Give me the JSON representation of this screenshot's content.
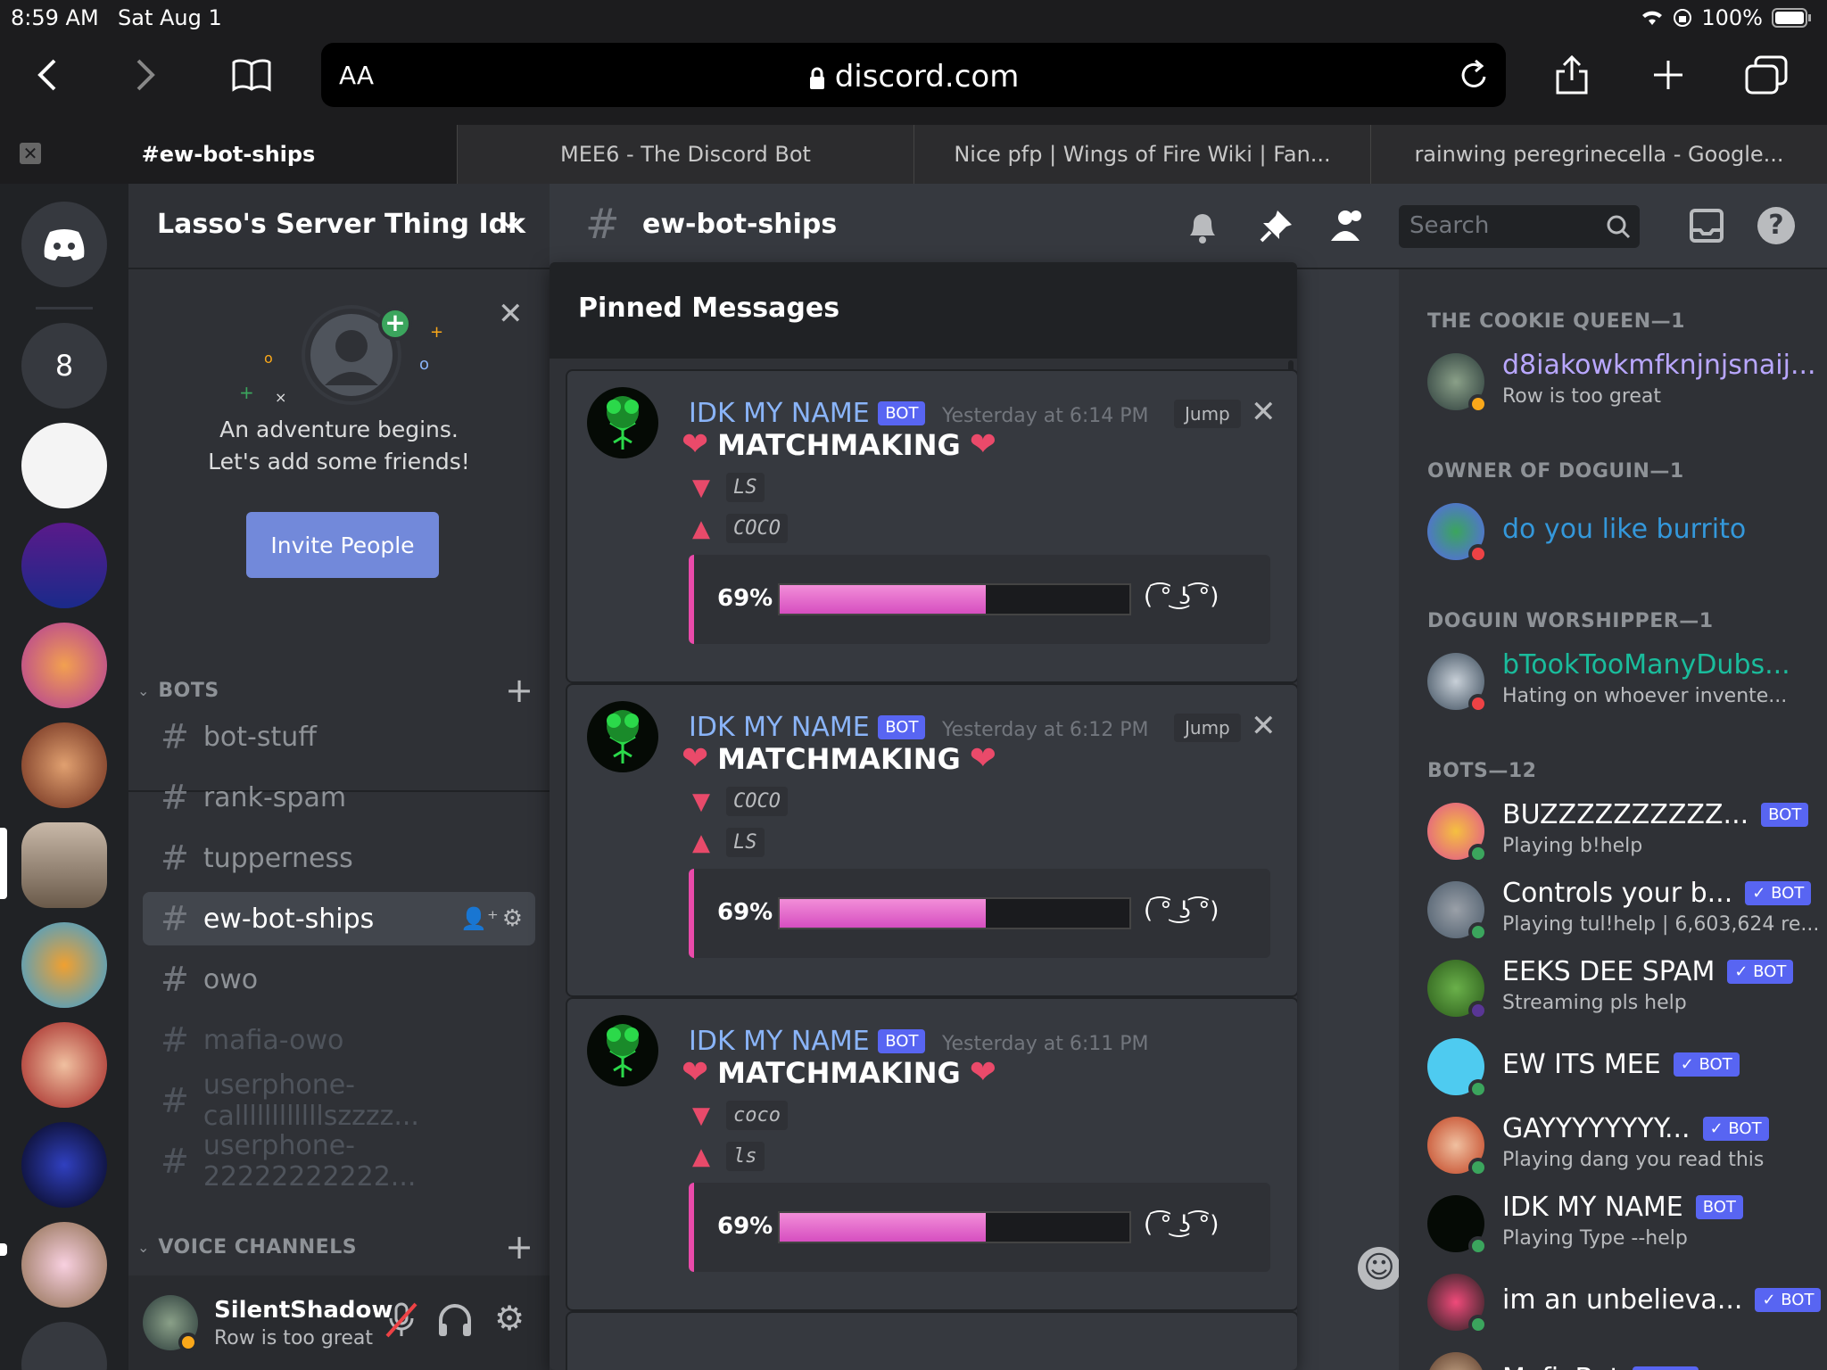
{
  "status_bar": {
    "time": "8:59 AM",
    "date": "Sat Aug 1",
    "battery": "100%"
  },
  "browser": {
    "url_domain": "discord.com",
    "aa_label": "AA",
    "tabs": [
      {
        "label": "#ew-bot-ships",
        "active": true
      },
      {
        "label": "MEE6 - The Discord Bot",
        "active": false
      },
      {
        "label": "Nice pfp | Wings of Fire Wiki | Fan...",
        "active": false
      },
      {
        "label": "rainwing peregrinecella - Google...",
        "active": false
      }
    ]
  },
  "guilds": {
    "unread_count": "8"
  },
  "server": {
    "name": "Lasso's Server Thing Idk",
    "invite_card": {
      "line1": "An adventure begins.",
      "line2": "Let's add some friends!",
      "button": "Invite People"
    },
    "categories": {
      "bots": "BOTS",
      "voice": "VOICE CHANNELS"
    },
    "channels": [
      {
        "name": "bot-stuff",
        "state": "normal"
      },
      {
        "name": "rank-spam",
        "state": "normal"
      },
      {
        "name": "tupperness",
        "state": "normal"
      },
      {
        "name": "ew-bot-ships",
        "state": "selected"
      },
      {
        "name": "owo",
        "state": "normal"
      },
      {
        "name": "mafia-owo",
        "state": "muted"
      },
      {
        "name": "userphone-callllllllllllszzzz...",
        "state": "muted"
      },
      {
        "name": "userphone-22222222222...",
        "state": "muted"
      }
    ]
  },
  "user": {
    "name": "SilentShadow",
    "status": "Row is too great"
  },
  "channel_header": {
    "name": "ew-bot-ships",
    "search_placeholder": "Search"
  },
  "pinned": {
    "title": "Pinned Messages",
    "messages": [
      {
        "author": "IDK MY NAME",
        "badge": "BOT",
        "time": "Yesterday at 6:14 PM",
        "jump": "Jump",
        "title": "MATCHMAKING",
        "down": "LS",
        "up": "COCO",
        "percent": "69%",
        "face": "( ͡° ͜ʖ ͡°)",
        "level": 0.59
      },
      {
        "author": "IDK MY NAME",
        "badge": "BOT",
        "time": "Yesterday at 6:12 PM",
        "jump": "Jump",
        "title": "MATCHMAKING",
        "down": "COCO",
        "up": "LS",
        "percent": "69%",
        "face": "( ͡° ͜ʖ ͡°)",
        "level": 0.59
      },
      {
        "author": "IDK MY NAME",
        "badge": "BOT",
        "time": "Yesterday at 6:11 PM",
        "jump": "",
        "title": "MATCHMAKING",
        "down": "coco",
        "up": "ls",
        "percent": "69%",
        "face": "( ͡° ͜ʖ ͡°)",
        "level": 0.59
      }
    ]
  },
  "members": {
    "groups": [
      {
        "title": "THE COOKIE QUEEN—1",
        "items": [
          {
            "name": "d8iakowkmfknjnjsnaij...",
            "sub": "Row is too great",
            "name_color": "#b9a7ff",
            "bot": "",
            "status": "idle"
          }
        ]
      },
      {
        "title": "OWNER OF DOGUIN—1",
        "items": [
          {
            "name": "do you like burrito",
            "sub": "",
            "name_color": "#3498db",
            "bot": "",
            "status": "dnd"
          }
        ]
      },
      {
        "title": "DOGUIN WORSHIPPER—1",
        "items": [
          {
            "name": "bTookTooManyDubs...",
            "sub": "Hating on whoever invente...",
            "name_color": "#1abc9c",
            "bot": "",
            "status": "dnd"
          }
        ]
      },
      {
        "title": "BOTS—12",
        "items": [
          {
            "name": "BUZZZZZZZZZZ...",
            "sub": "Playing b!help",
            "name_color": "#ffffff",
            "bot": "BOT",
            "status": "online"
          },
          {
            "name": "Controls your b...",
            "sub": "Playing tul!help | 6,603,624 re...",
            "name_color": "#ffffff",
            "bot": "✓ BOT",
            "status": "online"
          },
          {
            "name": "EEKS DEE SPAM",
            "sub": "Streaming pls help",
            "name_color": "#ffffff",
            "bot": "✓ BOT",
            "status": "streaming"
          },
          {
            "name": "EW ITS MEE",
            "sub": "",
            "name_color": "#ffffff",
            "bot": "✓ BOT",
            "status": "online"
          },
          {
            "name": "GAYYYYYYYY...",
            "sub": "Playing dang you read this",
            "name_color": "#ffffff",
            "bot": "✓ BOT",
            "status": "online"
          },
          {
            "name": "IDK MY NAME",
            "sub": "Playing Type --help",
            "name_color": "#ffffff",
            "bot": "BOT",
            "status": "online"
          },
          {
            "name": "im an unbelieva...",
            "sub": "",
            "name_color": "#ffffff",
            "bot": "✓ BOT",
            "status": "online"
          },
          {
            "name": "MafiaBot",
            "sub": "",
            "name_color": "#ffffff",
            "bot": "✓ BOT",
            "status": "online"
          }
        ]
      }
    ]
  },
  "colors": {
    "accent": "#5865f2",
    "online": "#3ba55d",
    "idle": "#faa81a",
    "dnd": "#ed4245",
    "streaming": "#593695",
    "pink": "#ea4aaa"
  }
}
